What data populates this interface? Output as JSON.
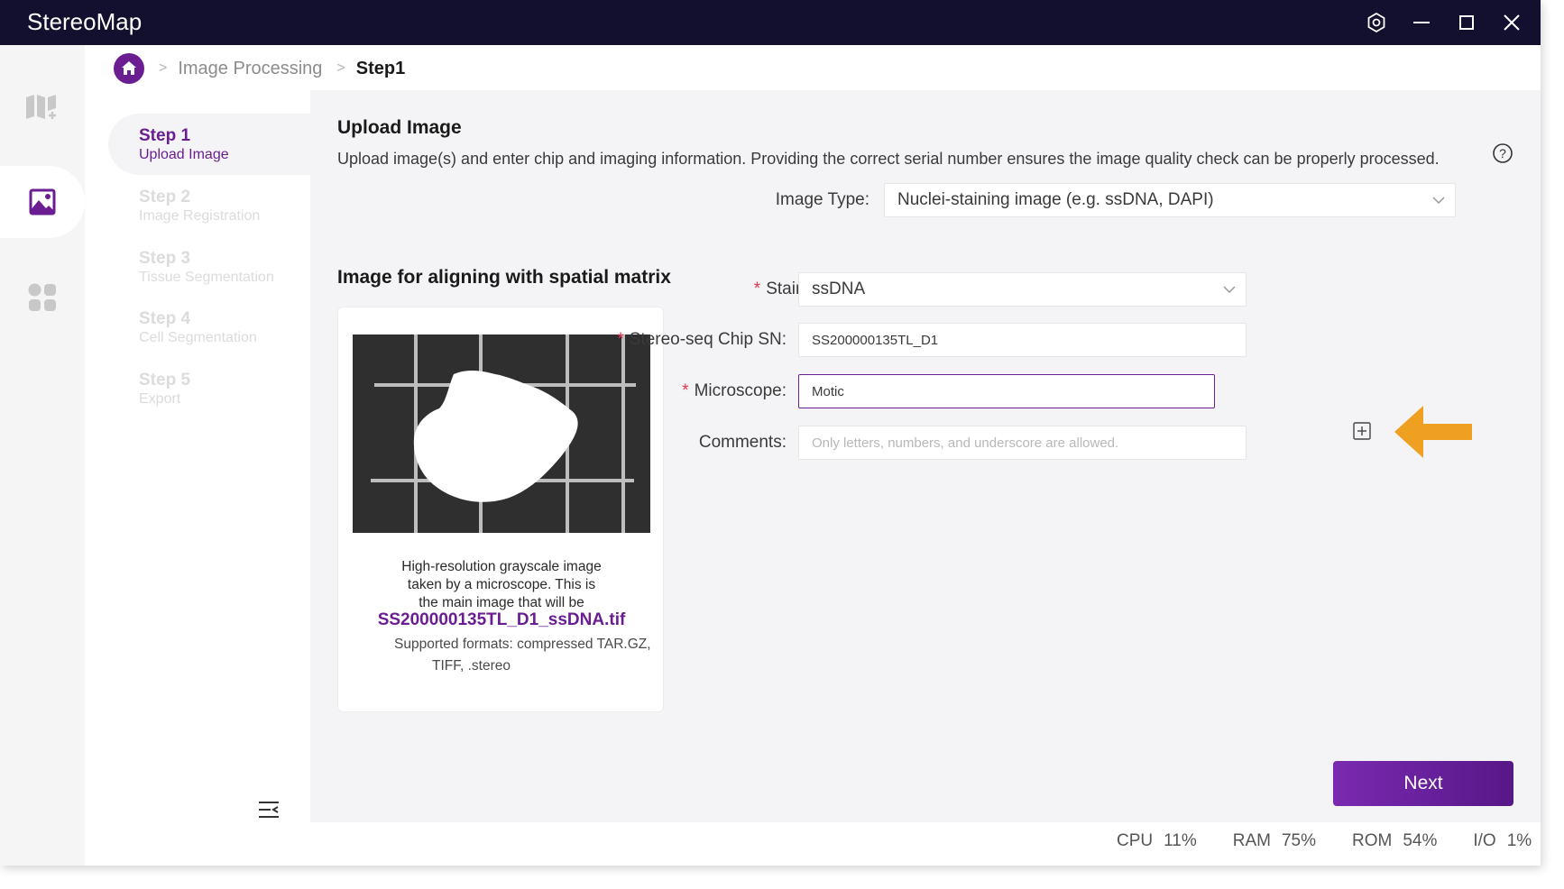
{
  "app": {
    "title": "StereoMap"
  },
  "window_controls": [
    "settings-icon",
    "minimize-icon",
    "maximize-icon",
    "close-icon"
  ],
  "rail": {
    "items": [
      "map-icon",
      "image-icon",
      "apps-icon"
    ],
    "active": "image-icon"
  },
  "breadcrumb": {
    "items": [
      "Image Processing",
      "Step1"
    ]
  },
  "steps": [
    {
      "num": "Step 1",
      "label": "Upload Image",
      "active": true
    },
    {
      "num": "Step 2",
      "label": "Image Registration",
      "active": false
    },
    {
      "num": "Step 3",
      "label": "Tissue Segmentation",
      "active": false
    },
    {
      "num": "Step 4",
      "label": "Cell Segmentation",
      "active": false
    },
    {
      "num": "Step 5",
      "label": "Export",
      "active": false
    }
  ],
  "main": {
    "title": "Upload Image",
    "description": "Upload image(s) and enter chip and imaging information. Providing the correct serial number ensures the image quality check can be properly processed.",
    "image_type_label": "Image Type:",
    "image_type_value": "Nuclei-staining image (e.g. ssDNA, DAPI)",
    "section_title": "Image for aligning with spatial matrix",
    "form": {
      "staining_label": "Staining Type",
      "staining_value": "ssDNA",
      "chip_label": "Stereo-seq Chip SN:",
      "chip_value": "SS200000135TL_D1",
      "microscope_label": "Microscope:",
      "microscope_value": "Motic",
      "comments_label": "Comments:",
      "comments_placeholder": "Only letters, numbers, and underscore are allowed."
    },
    "upload": {
      "description": "High-resolution grayscale image taken by a microscope. This is the main image that will be",
      "filename": "SS200000135TL_D1_ssDNA.tif",
      "formats_line1": "Supported formats: compressed TAR.GZ,",
      "formats_line2": "TIFF, .stereo"
    },
    "next_label": "Next"
  },
  "status": [
    {
      "label": "CPU",
      "value": "11%"
    },
    {
      "label": "RAM",
      "value": "75%"
    },
    {
      "label": "ROM",
      "value": "54%"
    },
    {
      "label": "I/O",
      "value": "1%"
    }
  ],
  "colors": {
    "accent": "#6a1e91",
    "titlebar": "#130f2e",
    "arrow": "#f0a020",
    "required": "#e0374a"
  }
}
